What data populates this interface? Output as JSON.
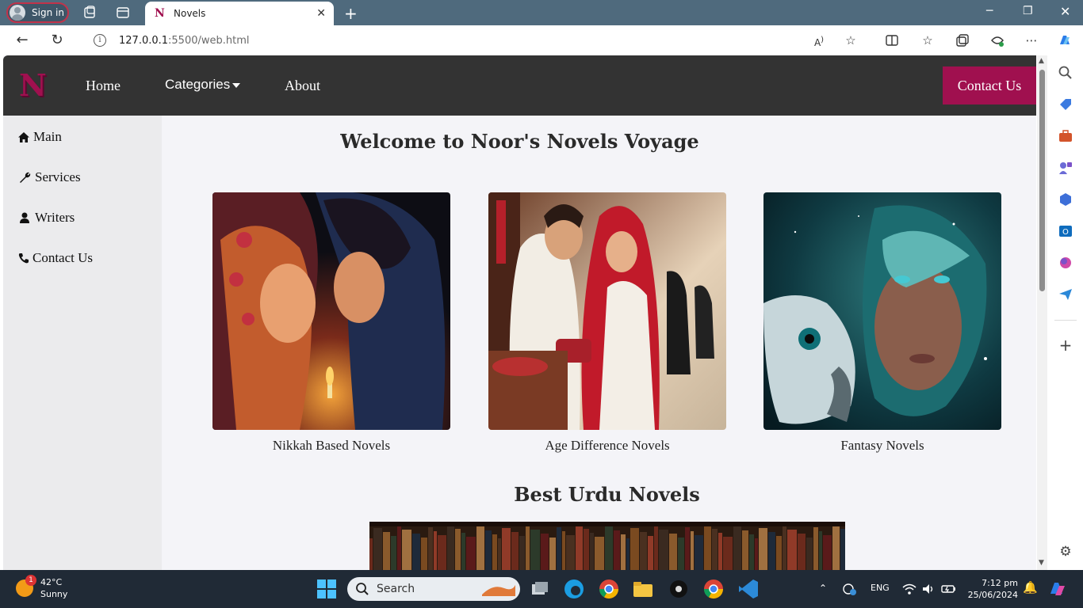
{
  "browser": {
    "signin_label": "Sign in",
    "tab_title": "Novels",
    "tab_favicon": "N",
    "url_host": "127.0.0.1",
    "url_rest": ":5500/web.html"
  },
  "site": {
    "logo": "N",
    "nav": {
      "home": "Home",
      "categories": "Categories",
      "about": "About",
      "contact": "Contact Us"
    },
    "sidebar": [
      {
        "label": "Main",
        "icon": "home-icon"
      },
      {
        "label": "Services",
        "icon": "wrench-icon"
      },
      {
        "label": "Writers",
        "icon": "user-icon"
      },
      {
        "label": "Contact Us",
        "icon": "phone-icon"
      }
    ],
    "welcome_title": "Welcome to Noor's Novels Voyage",
    "cards": [
      {
        "caption": "Nikkah Based Novels"
      },
      {
        "caption": "Age Difference Novels"
      },
      {
        "caption": "Fantasy Novels"
      }
    ],
    "best_title": "Best Urdu Novels",
    "brand_color": "#a0104f",
    "nav_bg": "#333333"
  },
  "taskbar": {
    "temperature": "42°C",
    "condition": "Sunny",
    "weather_badge": "1",
    "search_placeholder": "Search",
    "language": "ENG",
    "time": "7:12 pm",
    "date": "25/06/2024"
  }
}
